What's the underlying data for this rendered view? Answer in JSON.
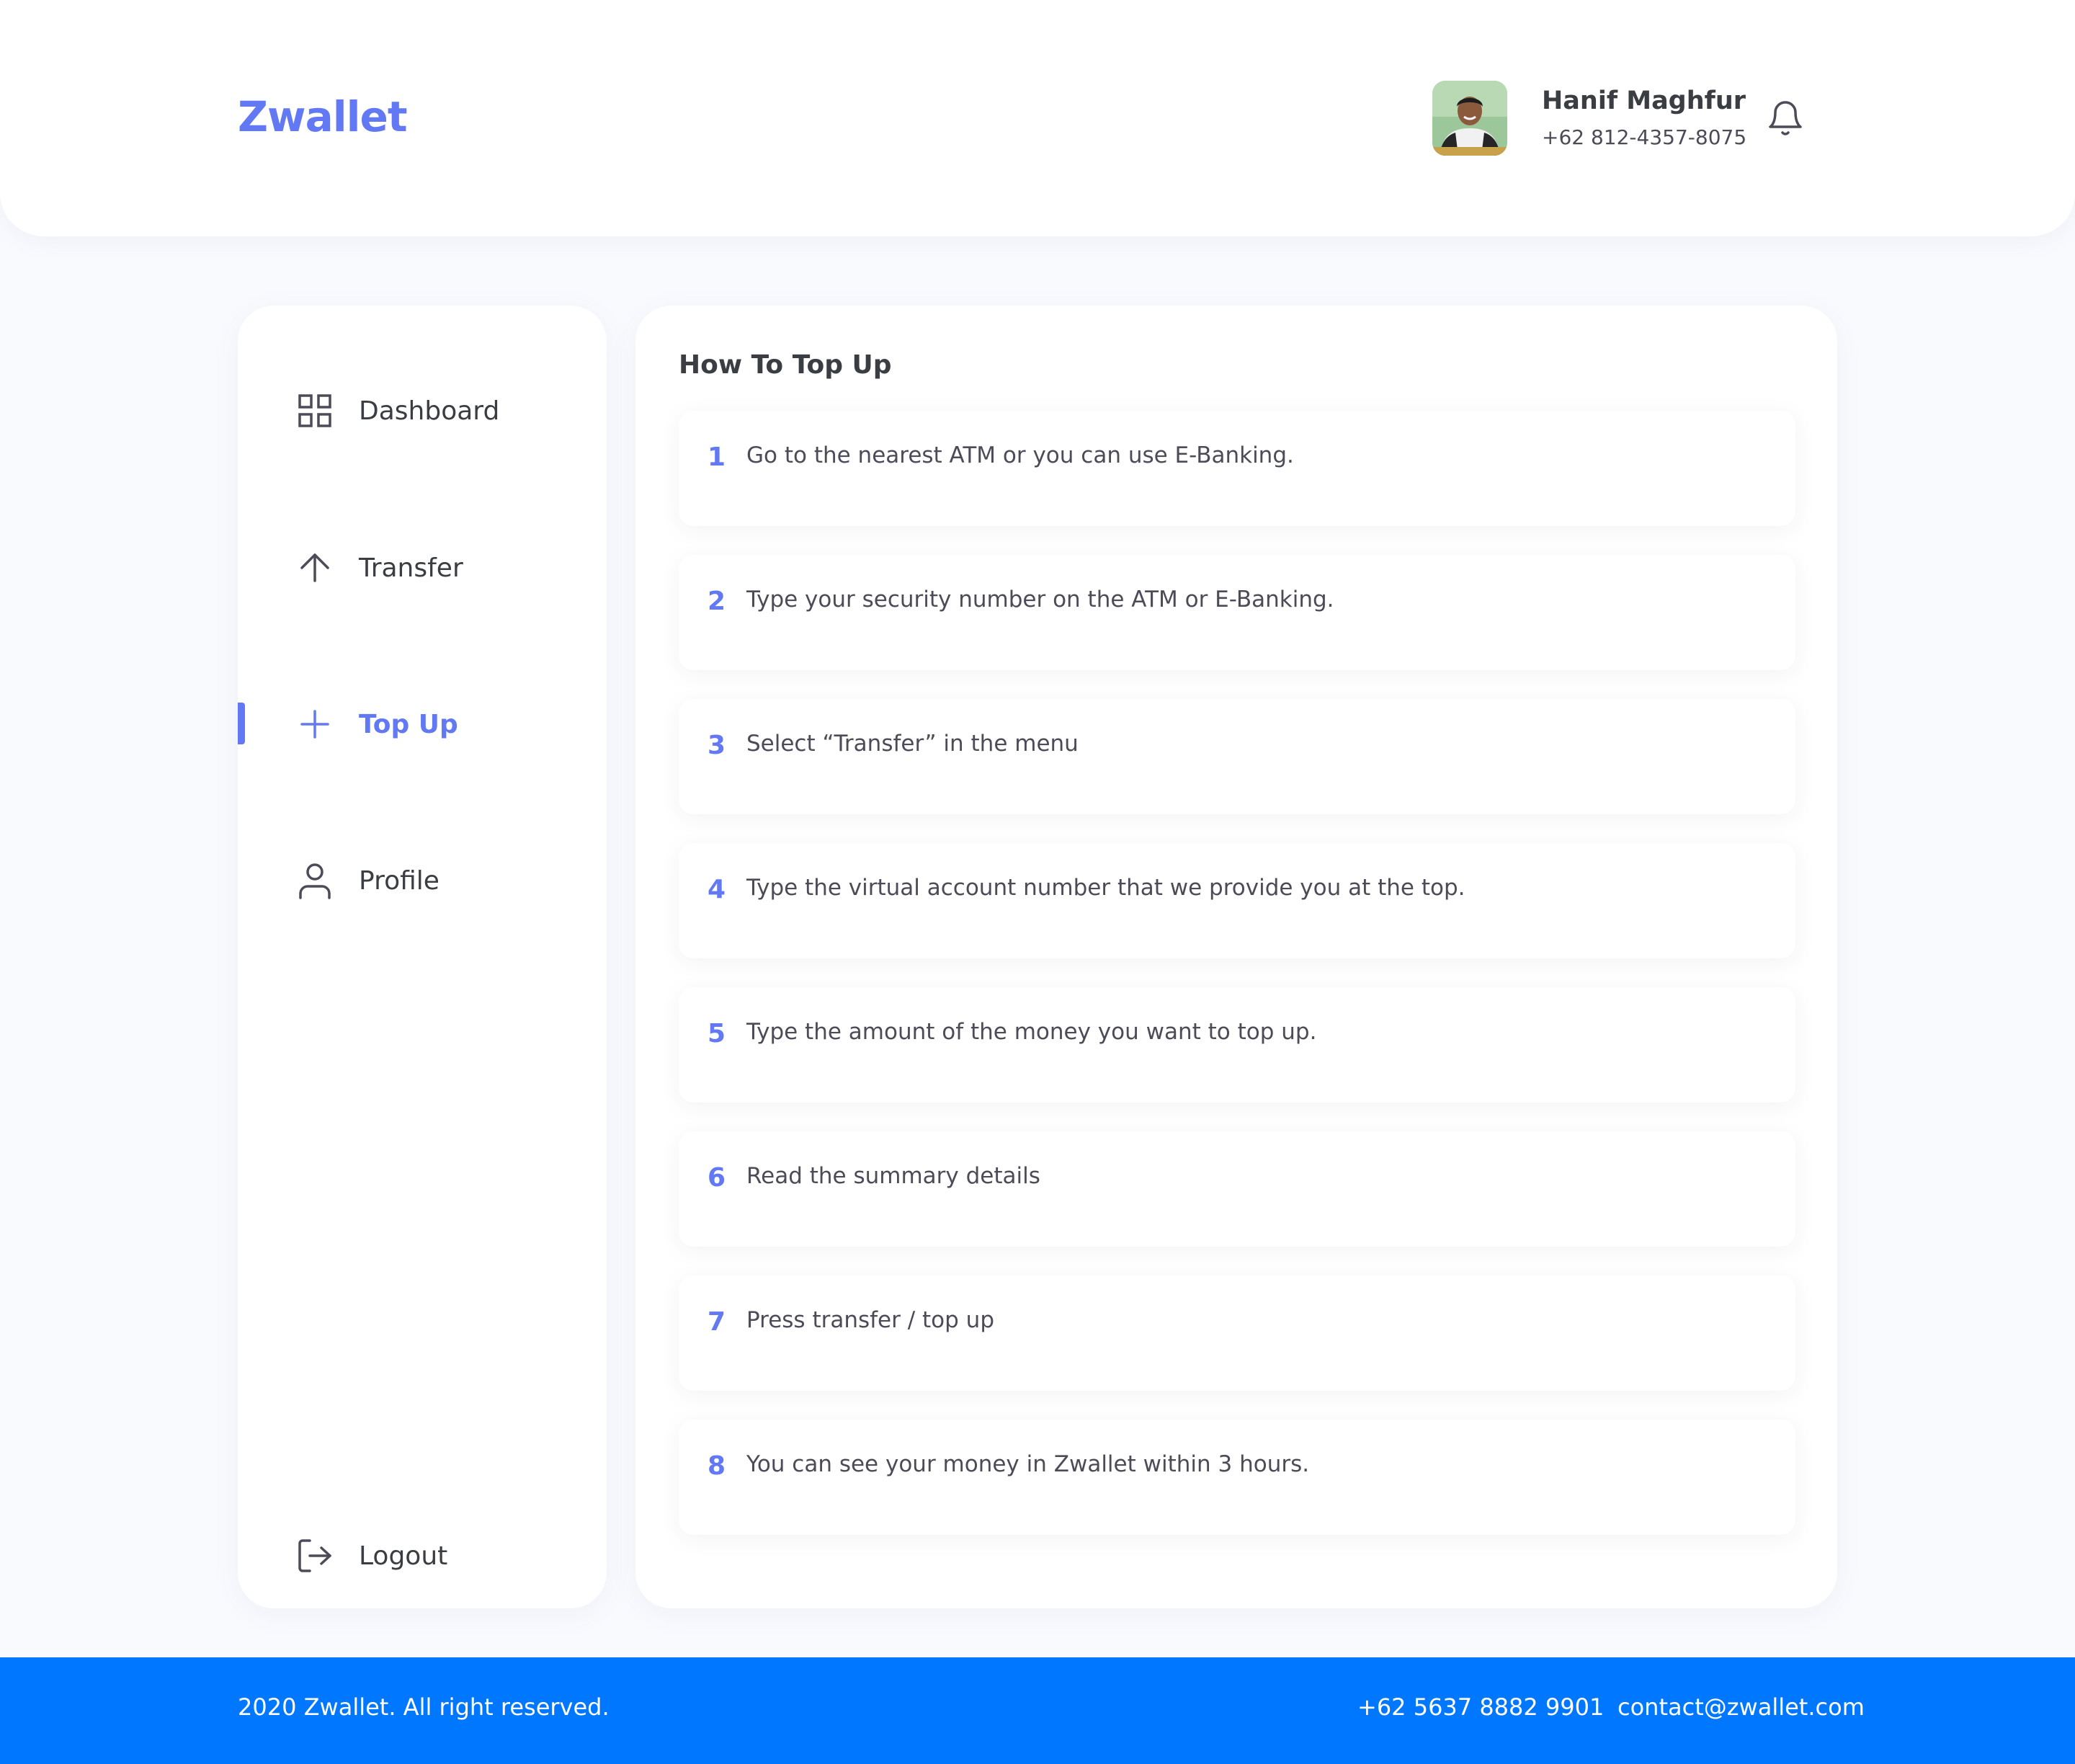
{
  "app": {
    "brand": "Zwallet",
    "accent_color": "#6379f4"
  },
  "header": {
    "user_name": "Hanif Maghfur",
    "user_phone": "+62 812-4357-8075",
    "avatar_icon": "user-avatar-photo",
    "notification_icon": "bell-icon"
  },
  "sidebar": {
    "items": [
      {
        "label": "Dashboard",
        "icon": "grid-icon",
        "active": false
      },
      {
        "label": "Transfer",
        "icon": "arrow-up-icon",
        "active": false
      },
      {
        "label": "Top Up",
        "icon": "plus-icon",
        "active": true
      },
      {
        "label": "Profile",
        "icon": "user-icon",
        "active": false
      }
    ],
    "logout": {
      "label": "Logout",
      "icon": "logout-icon"
    }
  },
  "main": {
    "title": "How To Top Up",
    "steps": [
      {
        "num": "1",
        "text": "Go to the nearest ATM or you can use E-Banking."
      },
      {
        "num": "2",
        "text": "Type your security number on the ATM or E-Banking."
      },
      {
        "num": "3",
        "text": "Select “Transfer” in the menu"
      },
      {
        "num": "4",
        "text": "Type the virtual account number that we provide you at the top."
      },
      {
        "num": "5",
        "text": "Type the amount of the money you want to top up."
      },
      {
        "num": "6",
        "text": "Read the summary details"
      },
      {
        "num": "7",
        "text": "Press transfer / top up"
      },
      {
        "num": "8",
        "text": "You can see your money in Zwallet within 3 hours."
      }
    ]
  },
  "footer": {
    "copyright": "2020 Zwallet. All right reserved.",
    "phone": "+62 5637 8882 9901",
    "email": "contact@zwallet.com",
    "background_color": "#0077ff"
  }
}
